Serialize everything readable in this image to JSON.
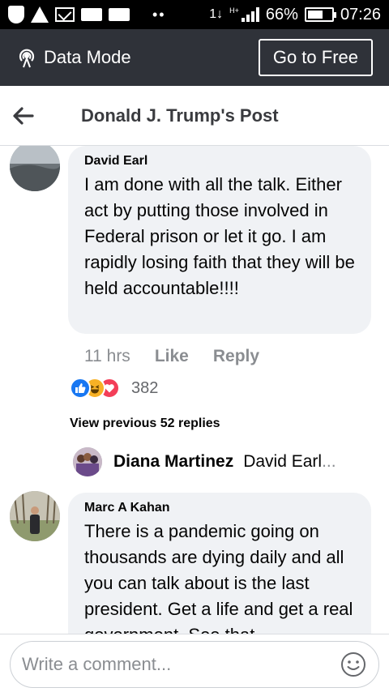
{
  "status_bar": {
    "battery": "66%",
    "time": "07:26",
    "network": "1↓",
    "signal_label": "H+"
  },
  "data_bar": {
    "label": "Data Mode",
    "go_free": "Go to Free"
  },
  "header": {
    "title": "Donald J. Trump's Post"
  },
  "comment1": {
    "author": "David Earl",
    "text": "I am done with all the talk. Either act by putting those involved in Federal prison or let it go. I am rapidly losing faith that they will be held accountable!!!!",
    "time": "11 hrs",
    "like": "Like",
    "reply": "Reply",
    "reaction_count": "382",
    "view_previous": "View previous 52 replies",
    "reply_preview": {
      "name": "Diana Martinez",
      "snippet": "David Earl",
      "ellipsis": "..."
    }
  },
  "comment2": {
    "author": "Marc A Kahan",
    "text": "There is a pandemic going on thousands are dying daily and all you can talk about is the last president. Get a life and get a real government. See that"
  },
  "composer": {
    "placeholder": "Write a comment..."
  },
  "colors": {
    "status_bar": "#000000",
    "data_bar": "#2f3239",
    "bubble": "#f0f2f5",
    "like_blue": "#1877f2",
    "haha_yellow": "#f7b125",
    "love_red": "#f33e58"
  },
  "icons": [
    "shield-icon",
    "warning-icon",
    "mail-icon",
    "signal-icon",
    "battery-icon",
    "data-mode-icon",
    "back-arrow-icon",
    "like-reaction-icon",
    "haha-reaction-icon",
    "love-reaction-icon",
    "emoji-icon"
  ]
}
